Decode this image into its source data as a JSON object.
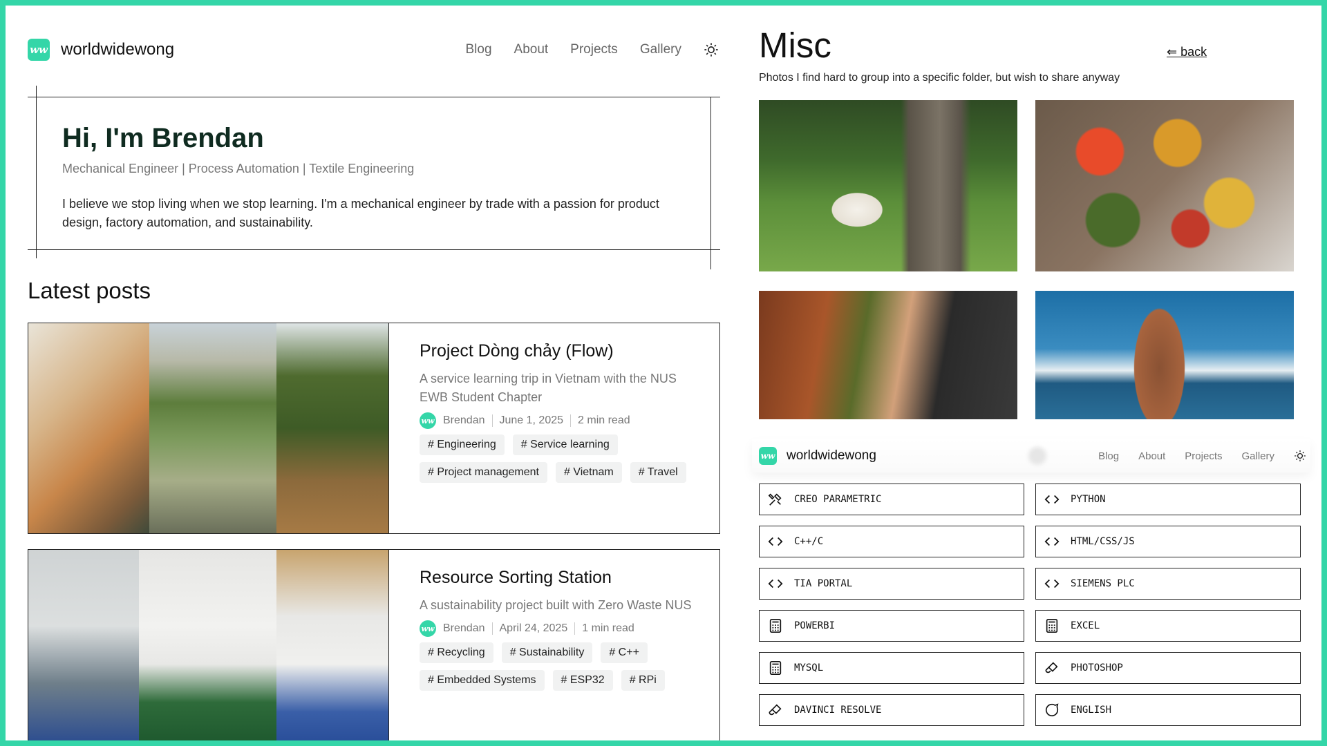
{
  "site": {
    "logo_text": "ww",
    "brand": "worldwidewong",
    "nav": [
      "Blog",
      "About",
      "Projects",
      "Gallery"
    ]
  },
  "hero": {
    "title": "Hi, I'm Brendan",
    "subtitle": "Mechanical Engineer | Process Automation | Textile Engineering",
    "bio": "I believe we stop living when we stop learning. I'm a mechanical engineer by trade with a passion for product design, factory automation, and sustainability."
  },
  "latest_posts": {
    "heading": "Latest posts",
    "posts": [
      {
        "title": "Project Dòng chảy (Flow)",
        "description": "A service learning trip in Vietnam with the NUS EWB Student Chapter",
        "author": "Brendan",
        "date": "June 1, 2025",
        "read_time": "2 min read",
        "tags": [
          "Engineering",
          "Service learning",
          "Project management",
          "Vietnam",
          "Travel"
        ]
      },
      {
        "title": "Resource Sorting Station",
        "description": "A sustainability project built with Zero Waste NUS",
        "author": "Brendan",
        "date": "April 24, 2025",
        "read_time": "1 min read",
        "tags": [
          "Recycling",
          "Sustainability",
          "C++",
          "Embedded Systems",
          "ESP32",
          "RPi"
        ]
      }
    ]
  },
  "misc": {
    "title": "Misc",
    "back_label": "⇐ back",
    "subtitle": "Photos I find hard to group into a specific folder, but wish to share anyway"
  },
  "skills": [
    {
      "label": "CREO PARAMETRIC",
      "icon": "tools-icon"
    },
    {
      "label": "PYTHON",
      "icon": "code-icon"
    },
    {
      "label": "C++/C",
      "icon": "code-icon"
    },
    {
      "label": "HTML/CSS/JS",
      "icon": "code-icon"
    },
    {
      "label": "TIA PORTAL",
      "icon": "code-icon"
    },
    {
      "label": "SIEMENS PLC",
      "icon": "code-icon"
    },
    {
      "label": "POWERBI",
      "icon": "calculator-icon"
    },
    {
      "label": "EXCEL",
      "icon": "calculator-icon"
    },
    {
      "label": "MYSQL",
      "icon": "calculator-icon"
    },
    {
      "label": "PHOTOSHOP",
      "icon": "brush-icon"
    },
    {
      "label": "DAVINCI RESOLVE",
      "icon": "brush-icon"
    },
    {
      "label": "ENGLISH",
      "icon": "chat-icon"
    }
  ],
  "colors": {
    "accent": "#34d6a8",
    "heading": "#0f2b20",
    "muted": "#777777",
    "tag_bg": "#f1f2f2"
  }
}
